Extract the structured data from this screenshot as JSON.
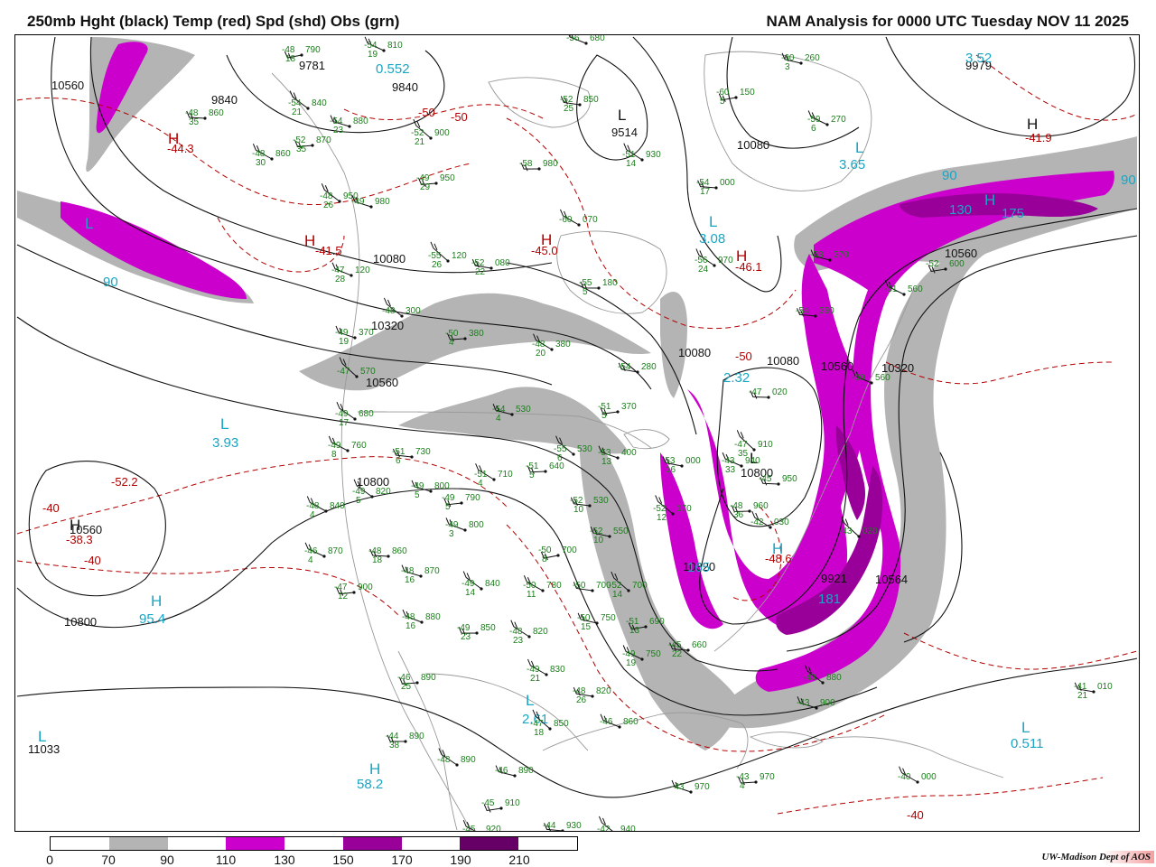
{
  "header": {
    "left_title": "250mb Hght (black) Temp (red) Spd (shd) Obs (grn)",
    "right_title": "NAM Analysis for 0000 UTC Tuesday  NOV 11 2025"
  },
  "legend": {
    "ticks": [
      "0",
      "70",
      "90",
      "110",
      "130",
      "150",
      "170",
      "190",
      "210"
    ],
    "segments": [
      {
        "range": "0-70",
        "color": "#ffffff"
      },
      {
        "range": "70-90",
        "color": "#b4b4b4"
      },
      {
        "range": "90-110",
        "color": "#ffffff"
      },
      {
        "range": "110-130",
        "color": "#cc00cc"
      },
      {
        "range": "130-150",
        "color": "#ffffff"
      },
      {
        "range": "150-170",
        "color": "#990099"
      },
      {
        "range": "170-190",
        "color": "#ffffff"
      },
      {
        "range": "190-210",
        "color": "#660066"
      },
      {
        "range": "210+",
        "color": "#ffffff"
      }
    ]
  },
  "credit": "UW-Madison   Dept of AOS",
  "colors": {
    "height_contour": "#111111",
    "temperature_contour": "#b30000",
    "speed_label": "#19a5c3",
    "observations": "#1a7f1a",
    "shade_70_90": "#b4b4b4",
    "shade_110_130": "#cc00cc",
    "shade_150_170": "#990099",
    "shade_190_210": "#660066",
    "coastline": "#999999"
  },
  "height_labels": [
    "10560",
    "9840",
    "9781",
    "9840",
    "9514",
    "10080",
    "9979",
    "10560",
    "10080",
    "10320",
    "10560",
    "10800",
    "10080",
    "10080",
    "10320",
    "10560",
    "10800",
    "10320",
    "9921",
    "10560",
    "10564",
    "10800",
    "11033"
  ],
  "temperature_labels": [
    "-50",
    "-50",
    "-45.0",
    "-44.3",
    "-41.5",
    "-46.1",
    "-50",
    "-52.2",
    "-40",
    "-38.3",
    "-40",
    "-41.9",
    "-48.6",
    "-40"
  ],
  "speed_labels": [
    "0.552",
    "3.65",
    "3.52",
    "3.08",
    "2.32",
    "3.93",
    "95.4",
    "2.61",
    "58.2",
    "0.511",
    "90",
    "90",
    "130",
    "175",
    "181",
    "165",
    "90"
  ],
  "pressure_centers": [
    {
      "letter": "H",
      "kind": "temp"
    },
    {
      "letter": "H",
      "kind": "temp"
    },
    {
      "letter": "H",
      "kind": "temp"
    },
    {
      "letter": "H",
      "kind": "temp"
    },
    {
      "letter": "L",
      "kind": "speed"
    },
    {
      "letter": "L",
      "kind": "speed"
    },
    {
      "letter": "L",
      "kind": "speed"
    },
    {
      "letter": "L",
      "kind": "speed"
    },
    {
      "letter": "L",
      "kind": "speed"
    },
    {
      "letter": "L",
      "kind": "speed"
    },
    {
      "letter": "H",
      "kind": "speed"
    },
    {
      "letter": "H",
      "kind": "speed"
    },
    {
      "letter": "L",
      "kind": "height"
    },
    {
      "letter": "L",
      "kind": "height"
    },
    {
      "letter": "H",
      "kind": "height"
    },
    {
      "letter": "H",
      "kind": "height"
    },
    {
      "letter": "L",
      "kind": "speed"
    },
    {
      "letter": "H",
      "kind": "speed"
    },
    {
      "letter": "H",
      "kind": "speed"
    }
  ],
  "observations": [
    {
      "temp": "-48",
      "hgt": "790",
      "dew": "18"
    },
    {
      "temp": "-54",
      "hgt": "810",
      "dew": "19"
    },
    {
      "temp": "-48",
      "hgt": "860",
      "dew": "35"
    },
    {
      "temp": "-54",
      "hgt": "840",
      "dew": "21"
    },
    {
      "temp": "-54",
      "hgt": "880",
      "dew": "23"
    },
    {
      "temp": "-52",
      "hgt": "870",
      "dew": "35"
    },
    {
      "temp": "-48",
      "hgt": "860",
      "dew": "30"
    },
    {
      "temp": "-52",
      "hgt": "850",
      "dew": "25"
    },
    {
      "temp": "-52",
      "hgt": "900",
      "dew": "21"
    },
    {
      "temp": "-56",
      "hgt": "680",
      "dew": ""
    },
    {
      "temp": "-58",
      "hgt": "980",
      "dew": ""
    },
    {
      "temp": "-51",
      "hgt": "930",
      "dew": "14"
    },
    {
      "temp": "-60",
      "hgt": "260",
      "dew": "3"
    },
    {
      "temp": "-60",
      "hgt": "150",
      "dew": "5"
    },
    {
      "temp": "-59",
      "hgt": "270",
      "dew": "6"
    },
    {
      "temp": "-54",
      "hgt": "000",
      "dew": "17"
    },
    {
      "temp": "-48",
      "hgt": "950",
      "dew": "26"
    },
    {
      "temp": "-49",
      "hgt": "980",
      "dew": ""
    },
    {
      "temp": "-49",
      "hgt": "950",
      "dew": "29"
    },
    {
      "temp": "-60",
      "hgt": "070",
      "dew": ""
    },
    {
      "temp": "-52",
      "hgt": "080",
      "dew": "22"
    },
    {
      "temp": "-55",
      "hgt": "120",
      "dew": "26"
    },
    {
      "temp": "-47",
      "hgt": "120",
      "dew": "28"
    },
    {
      "temp": "-55",
      "hgt": "180",
      "dew": "5"
    },
    {
      "temp": "-56",
      "hgt": "970",
      "dew": "24"
    },
    {
      "temp": "-53",
      "hgt": "370",
      "dew": ""
    },
    {
      "temp": "-52",
      "hgt": "600",
      "dew": ""
    },
    {
      "temp": "-51",
      "hgt": "560",
      "dew": ""
    },
    {
      "temp": "-54",
      "hgt": "360",
      "dew": ""
    },
    {
      "temp": "-48",
      "hgt": "300",
      "dew": ""
    },
    {
      "temp": "-49",
      "hgt": "370",
      "dew": "19"
    },
    {
      "temp": "-50",
      "hgt": "380",
      "dew": "4"
    },
    {
      "temp": "-48",
      "hgt": "380",
      "dew": "20"
    },
    {
      "temp": "-54",
      "hgt": "280",
      "dew": ""
    },
    {
      "temp": "-47",
      "hgt": "570",
      "dew": ""
    },
    {
      "temp": "-50",
      "hgt": "560",
      "dew": ""
    },
    {
      "temp": "-47",
      "hgt": "020",
      "dew": ""
    },
    {
      "temp": "-49",
      "hgt": "680",
      "dew": "17"
    },
    {
      "temp": "-54",
      "hgt": "530",
      "dew": "4"
    },
    {
      "temp": "-51",
      "hgt": "370",
      "dew": "5"
    },
    {
      "temp": "-49",
      "hgt": "760",
      "dew": "8"
    },
    {
      "temp": "-51",
      "hgt": "730",
      "dew": "6"
    },
    {
      "temp": "-55",
      "hgt": "530",
      "dew": "6"
    },
    {
      "temp": "-53",
      "hgt": "400",
      "dew": "13"
    },
    {
      "temp": "-51",
      "hgt": "640",
      "dew": "5"
    },
    {
      "temp": "-51",
      "hgt": "710",
      "dew": "4"
    },
    {
      "temp": "-53",
      "hgt": "000",
      "dew": "16"
    },
    {
      "temp": "-47",
      "hgt": "910",
      "dew": "35"
    },
    {
      "temp": "-43",
      "hgt": "940",
      "dew": "33"
    },
    {
      "temp": "-45",
      "hgt": "950",
      "dew": ""
    },
    {
      "temp": "-49",
      "hgt": "820",
      "dew": "5"
    },
    {
      "temp": "-49",
      "hgt": "800",
      "dew": "5"
    },
    {
      "temp": "-49",
      "hgt": "790",
      "dew": "5"
    },
    {
      "temp": "-48",
      "hgt": "840",
      "dew": "4"
    },
    {
      "temp": "-52",
      "hgt": "530",
      "dew": "10"
    },
    {
      "temp": "-52",
      "hgt": "170",
      "dew": "12"
    },
    {
      "temp": "-49",
      "hgt": "800",
      "dew": "3"
    },
    {
      "temp": "-48",
      "hgt": "960",
      "dew": "36"
    },
    {
      "temp": "-42",
      "hgt": "030",
      "dew": ""
    },
    {
      "temp": "-52",
      "hgt": "550",
      "dew": "10"
    },
    {
      "temp": "-50",
      "hgt": "700",
      "dew": "8"
    },
    {
      "temp": "-46",
      "hgt": "870",
      "dew": "4"
    },
    {
      "temp": "-48",
      "hgt": "860",
      "dew": "18"
    },
    {
      "temp": "-49",
      "hgt": "840",
      "dew": "14"
    },
    {
      "temp": "-48",
      "hgt": "870",
      "dew": "16"
    },
    {
      "temp": "-47",
      "hgt": "900",
      "dew": "12"
    },
    {
      "temp": "-50",
      "hgt": "780",
      "dew": "11"
    },
    {
      "temp": "-50",
      "hgt": "700",
      "dew": ""
    },
    {
      "temp": "-52",
      "hgt": "700",
      "dew": "14"
    },
    {
      "temp": "-48",
      "hgt": "880",
      "dew": "16"
    },
    {
      "temp": "-49",
      "hgt": "850",
      "dew": "23"
    },
    {
      "temp": "-48",
      "hgt": "820",
      "dew": "23"
    },
    {
      "temp": "-50",
      "hgt": "750",
      "dew": "15"
    },
    {
      "temp": "-51",
      "hgt": "690",
      "dew": "13"
    },
    {
      "temp": "-49",
      "hgt": "750",
      "dew": "19"
    },
    {
      "temp": "-45",
      "hgt": "660",
      "dew": "22"
    },
    {
      "temp": "-43",
      "hgt": "880",
      "dew": ""
    },
    {
      "temp": "-43",
      "hgt": "900",
      "dew": ""
    },
    {
      "temp": "-46",
      "hgt": "890",
      "dew": "25"
    },
    {
      "temp": "-49",
      "hgt": "830",
      "dew": "21"
    },
    {
      "temp": "-48",
      "hgt": "820",
      "dew": "26"
    },
    {
      "temp": "-47",
      "hgt": "850",
      "dew": "18"
    },
    {
      "temp": "-46",
      "hgt": "860",
      "dew": ""
    },
    {
      "temp": "-44",
      "hgt": "890",
      "dew": "38"
    },
    {
      "temp": "-48",
      "hgt": "890",
      "dew": ""
    },
    {
      "temp": "-46",
      "hgt": "890",
      "dew": ""
    },
    {
      "temp": "-45",
      "hgt": "910",
      "dew": ""
    },
    {
      "temp": "-45",
      "hgt": "920",
      "dew": ""
    },
    {
      "temp": "-44",
      "hgt": "930",
      "dew": ""
    },
    {
      "temp": "-42",
      "hgt": "940",
      "dew": ""
    },
    {
      "temp": "-43",
      "hgt": "970",
      "dew": ""
    },
    {
      "temp": "-43",
      "hgt": "970",
      "dew": "4"
    },
    {
      "temp": "-40",
      "hgt": "000",
      "dew": ""
    },
    {
      "temp": "-41",
      "hgt": "010",
      "dew": "21"
    },
    {
      "temp": "-43",
      "hgt": "020",
      "dew": ""
    }
  ]
}
